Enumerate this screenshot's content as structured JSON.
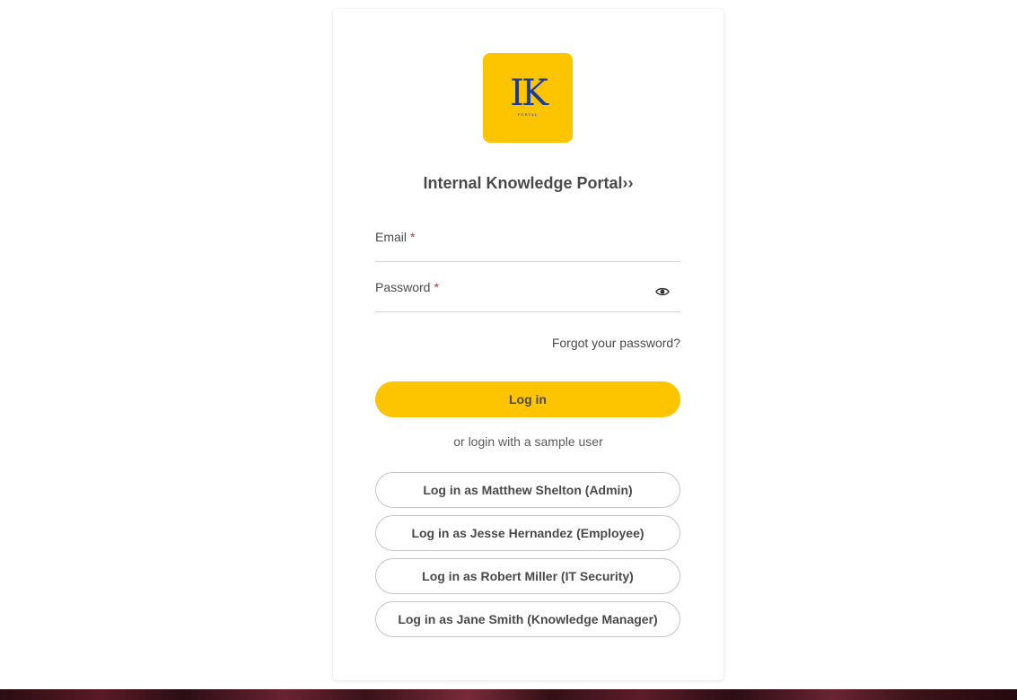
{
  "logo": {
    "mark": "IK",
    "sub": "PORTAL"
  },
  "title": "Internal Knowledge Portal››",
  "form": {
    "email": {
      "label": "Email",
      "required_mark": "*",
      "value": ""
    },
    "password": {
      "label": "Password",
      "required_mark": "*",
      "value": "",
      "toggle_icon": "eye-icon"
    },
    "forgot_label": "Forgot your password?",
    "login_label": "Log in"
  },
  "sample": {
    "intro": "or login with a sample user",
    "users": [
      {
        "label": "Log in as Matthew Shelton (Admin)"
      },
      {
        "label": "Log in as Jesse Hernandez (Employee)"
      },
      {
        "label": "Log in as Robert Miller (IT Security)"
      },
      {
        "label": "Log in as Jane Smith (Knowledge Manager)"
      }
    ]
  },
  "colors": {
    "accent": "#fdc400",
    "logo_text": "#1a3c9c",
    "required": "#e0242c",
    "text": "#4a4a4a"
  }
}
